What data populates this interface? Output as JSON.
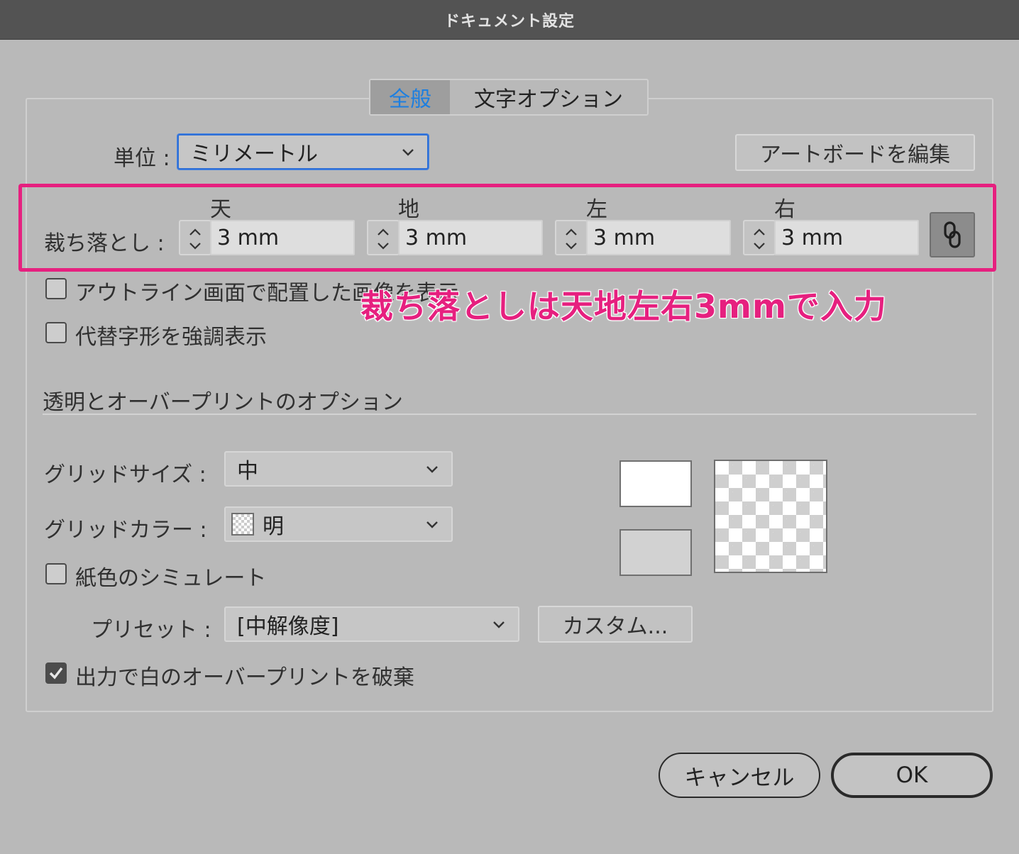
{
  "window": {
    "title": "ドキュメント設定"
  },
  "tabs": [
    {
      "label": "全般",
      "active": true
    },
    {
      "label": "文字オプション",
      "active": false
    }
  ],
  "units": {
    "label": "単位 :",
    "value": "ミリメートル"
  },
  "edit_artboard_label": "アートボードを編集",
  "bleed": {
    "label": "裁ち落とし :",
    "fields": [
      {
        "header": "天",
        "value": "3 mm"
      },
      {
        "header": "地",
        "value": "3 mm"
      },
      {
        "header": "左",
        "value": "3 mm"
      },
      {
        "header": "右",
        "value": "3 mm"
      }
    ]
  },
  "annotation": "裁ち落としは天地左右3mmで入力",
  "options": {
    "show_placed_images_label": "アウトライン画面で配置した画像を表示",
    "highlight_glyphs_label": "代替字形を強調表示"
  },
  "transparency": {
    "heading": "透明とオーバープリントのオプション",
    "grid_size": {
      "label": "グリッドサイズ :",
      "value": "中"
    },
    "grid_color": {
      "label": "グリッドカラー :",
      "value": "明"
    },
    "simulate_paper_label": "紙色のシミュレート",
    "preset": {
      "label": "プリセット :",
      "value": "[中解像度]"
    },
    "custom_label": "カスタム...",
    "discard_white_overprint_label": "出力で白のオーバープリントを破棄",
    "discard_white_overprint_checked": true
  },
  "footer": {
    "cancel_label": "キャンセル",
    "ok_label": "OK"
  },
  "colors": {
    "accent": "#1d7fe0",
    "annotation": "#e6207f",
    "focus": "#2e6fd6"
  }
}
